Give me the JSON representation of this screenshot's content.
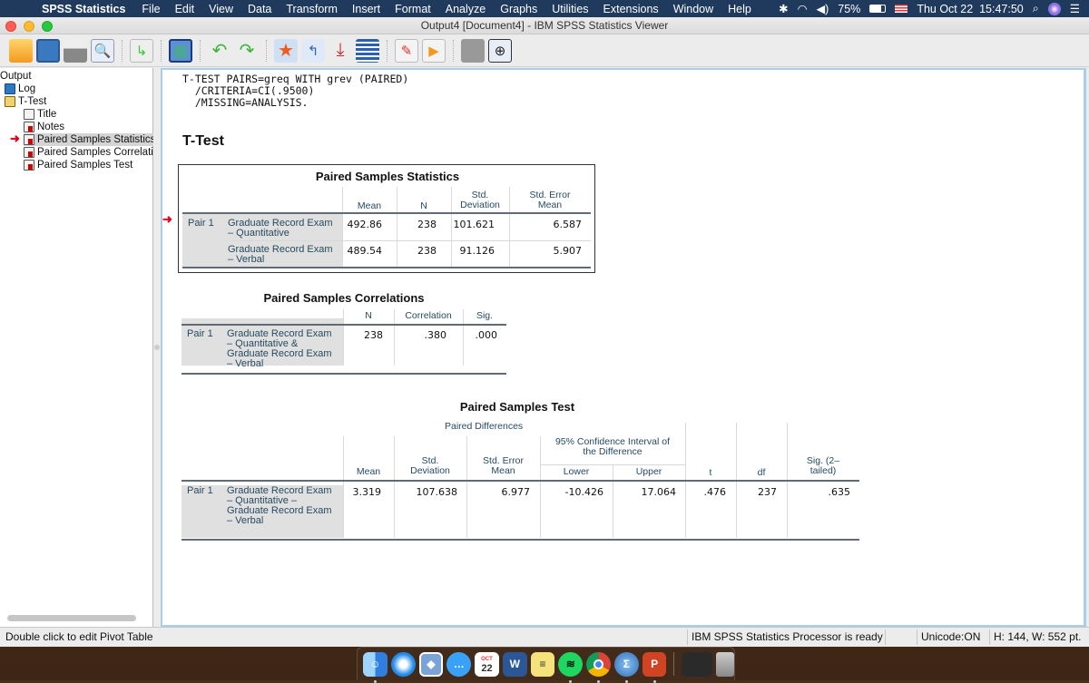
{
  "menubar": {
    "app_name": "SPSS Statistics",
    "items": [
      "File",
      "Edit",
      "View",
      "Data",
      "Transform",
      "Insert",
      "Format",
      "Analyze",
      "Graphs",
      "Utilities",
      "Extensions",
      "Window",
      "Help"
    ],
    "battery": "75%",
    "datetime": "Thu Oct 22  15:47:50"
  },
  "window": {
    "title": "Output4 [Document4] - IBM SPSS Statistics Viewer"
  },
  "toolbar": {
    "icons": [
      "open-icon",
      "save-icon",
      "print-icon",
      "print-preview-icon",
      "export-icon",
      "recall-dialog-icon",
      "undo-icon",
      "redo-icon",
      "goto-data-icon",
      "goto-case-icon",
      "goto-variable-icon",
      "variables-icon",
      "insert-output-icon",
      "run-icon",
      "designate-window-icon",
      "add-icon"
    ]
  },
  "outline": {
    "root": "Output",
    "items": [
      {
        "label": "Log",
        "level": 1,
        "icon": "log-icon"
      },
      {
        "label": "T-Test",
        "level": 1,
        "icon": "book-icon"
      },
      {
        "label": "Title",
        "level": 2,
        "icon": "title-icon"
      },
      {
        "label": "Notes",
        "level": 2,
        "icon": "notes-icon"
      },
      {
        "label": "Paired Samples Statistics",
        "level": 2,
        "icon": "table-icon",
        "selected": true
      },
      {
        "label": "Paired Samples Correlatio",
        "level": 2,
        "icon": "table-icon"
      },
      {
        "label": "Paired Samples Test",
        "level": 2,
        "icon": "table-icon"
      }
    ]
  },
  "viewer": {
    "syntax": "T-TEST PAIRS=greq WITH grev (PAIRED)\n  /CRITERIA=CI(.9500)\n  /MISSING=ANALYSIS.",
    "heading": "T-Test",
    "stats": {
      "title": "Paired Samples Statistics",
      "headers": [
        "Mean",
        "N",
        "Std.\nDeviation",
        "Std. Error\nMean"
      ],
      "pair": "Pair 1",
      "rows": [
        {
          "label": "Graduate Record Exam\n– Quantitative",
          "mean": "492.86",
          "n": "238",
          "sd": "101.621",
          "se": "6.587"
        },
        {
          "label": "Graduate Record Exam\n– Verbal",
          "mean": "489.54",
          "n": "238",
          "sd": "91.126",
          "se": "5.907"
        }
      ]
    },
    "corr": {
      "title": "Paired Samples Correlations",
      "headers": [
        "N",
        "Correlation",
        "Sig."
      ],
      "pair": "Pair 1",
      "row": {
        "label": "Graduate Record Exam\n– Quantitative &\nGraduate Record Exam\n– Verbal",
        "n": "238",
        "corr": ".380",
        "sig": ".000"
      }
    },
    "test": {
      "title": "Paired Samples Test",
      "group": "Paired Differences",
      "ci_header": "95% Confidence Interval of\nthe Difference",
      "headers": {
        "mean": "Mean",
        "sd": "Std.\nDeviation",
        "se": "Std. Error\nMean",
        "lower": "Lower",
        "upper": "Upper",
        "t": "t",
        "df": "df",
        "sig": "Sig. (2–\ntailed)"
      },
      "pair": "Pair 1",
      "row": {
        "label": "Graduate Record Exam\n– Quantitative –\nGraduate Record Exam\n– Verbal",
        "mean": "3.319",
        "sd": "107.638",
        "se": "6.977",
        "lower": "-10.426",
        "upper": "17.064",
        "t": ".476",
        "df": "237",
        "sig": ".635"
      }
    }
  },
  "statusbar": {
    "hint": "Double click to edit Pivot Table",
    "processor": "IBM SPSS Statistics Processor is ready",
    "unicode": "Unicode:ON",
    "size": "H: 144, W: 552 pt."
  },
  "dock": {
    "apps": [
      "Finder",
      "Safari",
      "Preview",
      "Messages",
      "Calendar",
      "Word",
      "Stickies",
      "Spotify",
      "Chrome",
      "SPSS Statistics",
      "PowerPoint"
    ],
    "calendar_day": "22",
    "calendar_month": "OCT"
  }
}
